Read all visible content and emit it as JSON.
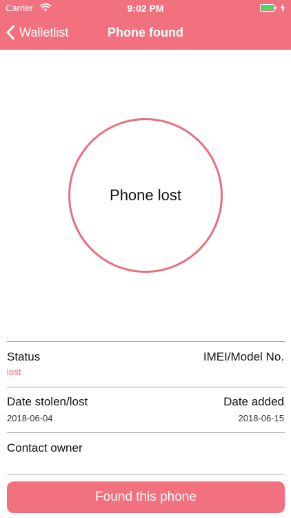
{
  "colors": {
    "accent": "#f1717f",
    "circle_border": "#ea6e7b",
    "status_text": "#ea6e7b"
  },
  "status_bar": {
    "carrier": "Carrier",
    "time": "9:02 PM",
    "icons": [
      "wifi-icon",
      "battery-icon",
      "charging-icon"
    ]
  },
  "nav": {
    "back_label": "Walletlist",
    "back_icon": "chevron-left-icon",
    "title": "Phone found"
  },
  "circle": {
    "label": "Phone lost"
  },
  "details": {
    "status_label": "Status",
    "status_value": "lost",
    "imei_label": "IMEI/Model No.",
    "date_stolen_label": "Date stolen/lost",
    "date_stolen_value": "2018-06-04",
    "date_added_label": "Date added",
    "date_added_value": "2018-06-15",
    "contact_label": "Contact owner"
  },
  "action": {
    "found_label": "Found this phone"
  }
}
